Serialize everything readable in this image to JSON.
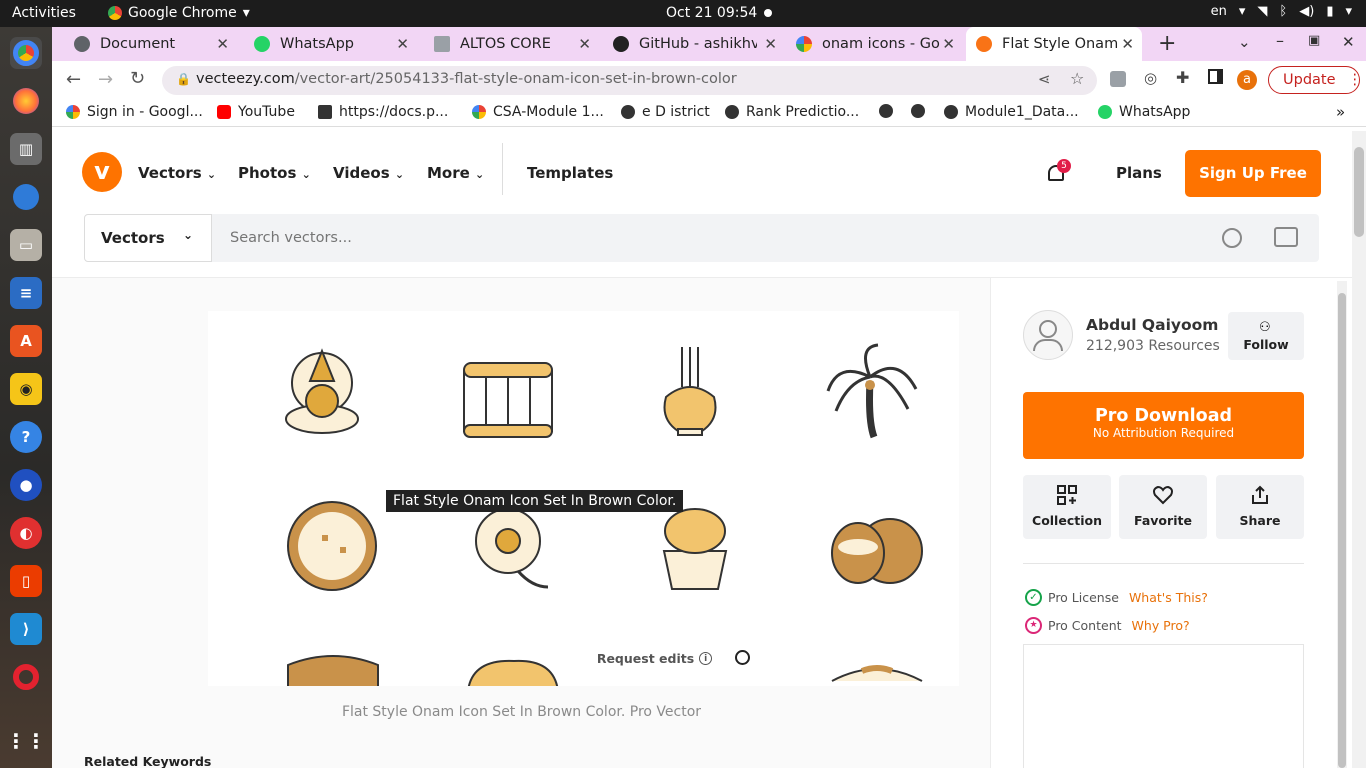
{
  "os_bar": {
    "activities": "Activities",
    "app_name": "Google Chrome",
    "datetime": "Oct 21  09:54",
    "lang": "en"
  },
  "tabs": [
    {
      "title": "Document",
      "color": "#5f6368"
    },
    {
      "title": "WhatsApp",
      "color": "#25d366"
    },
    {
      "title": "ALTOS CORE",
      "color": "#9aa0a6"
    },
    {
      "title": "GitHub - ashikhvu",
      "color": "#222222"
    },
    {
      "title": "onam icons - Goo",
      "color": "#4285f4"
    },
    {
      "title": "Flat Style Onam I",
      "color": "#f97316"
    }
  ],
  "url": {
    "domain": "vecteezy.com",
    "path": "/vector-art/25054133-flat-style-onam-icon-set-in-brown-color",
    "update": "Update",
    "profile": "a"
  },
  "bookmarks": [
    "Sign in - Googl...",
    "YouTube",
    "https://docs.p...",
    "CSA-Module 1...",
    "e D istrict",
    "Rank Predictio...",
    "",
    "",
    "Module1_Data...",
    "WhatsApp"
  ],
  "header": {
    "nav": [
      "Vectors",
      "Photos",
      "Videos",
      "More"
    ],
    "templates": "Templates",
    "notif_count": "5",
    "plans": "Plans",
    "signup": "Sign Up Free"
  },
  "search": {
    "category": "Vectors",
    "placeholder": "Search vectors..."
  },
  "preview": {
    "tooltip": "Flat Style Onam Icon Set In Brown Color.",
    "request_edits": "Request edits",
    "caption": "Flat Style Onam Icon Set In Brown Color. Pro Vector"
  },
  "related": "Related Keywords",
  "sidebar": {
    "author": "Abdul Qaiyoom",
    "resources": "212,903 Resources",
    "follow": "Follow",
    "pro_download": "Pro Download",
    "no_attr": "No Attribution Required",
    "actions": [
      "Collection",
      "Favorite",
      "Share"
    ],
    "license": "Pro License",
    "whats_this": "What's This?",
    "content": "Pro Content",
    "why_pro": "Why Pro?"
  },
  "colors": {
    "brand": "#fe7300",
    "brown": "#c9924a",
    "cream": "#fbf0d8"
  }
}
